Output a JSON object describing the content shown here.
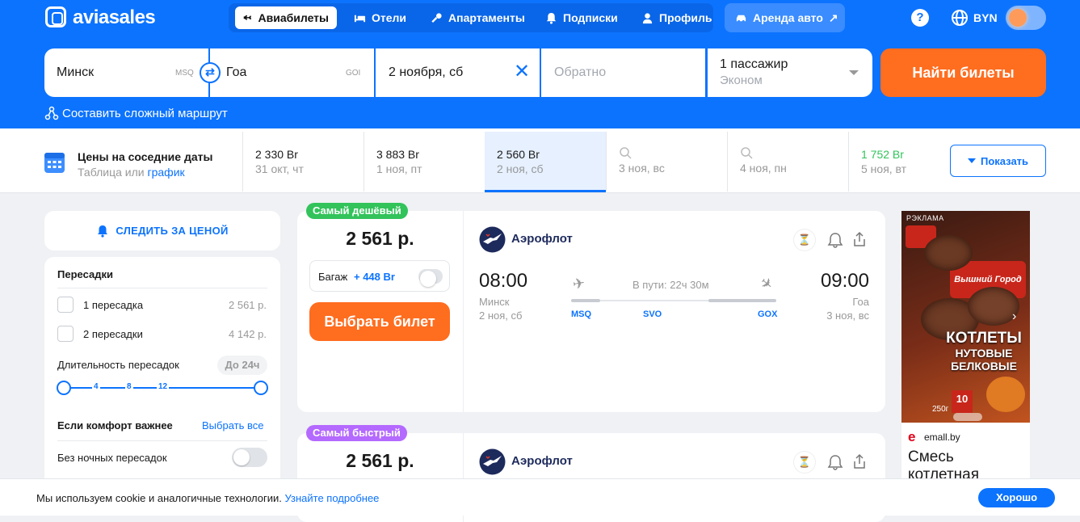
{
  "header": {
    "logo": "aviasales",
    "nav": [
      {
        "label": "Авиабилеты"
      },
      {
        "label": "Отели"
      },
      {
        "label": "Апартаменты"
      },
      {
        "label": "Подписки"
      },
      {
        "label": "Профиль"
      }
    ],
    "rent": "Аренда авто",
    "currency": "BYN",
    "help": "?"
  },
  "search": {
    "from": "Минск",
    "from_code": "MSQ",
    "to": "Гоа",
    "to_code": "GOI",
    "depart": "2 ноября, сб",
    "return_placeholder": "Обратно",
    "passengers": "1 пассажир",
    "cabin": "Эконом",
    "submit": "Найти билеты",
    "complex_route": "Составить сложный маршрут"
  },
  "dates": {
    "title": "Цены на соседние даты",
    "table": "Таблица",
    "or": "или",
    "graph": "график",
    "items": [
      {
        "price": "2 330 Br",
        "date": "31 окт, чт"
      },
      {
        "price": "3 883 Br",
        "date": "1 ноя, пт"
      },
      {
        "price": "2 560 Br",
        "date": "2 ноя, сб"
      },
      {
        "price": "",
        "date": "3 ноя, вс"
      },
      {
        "price": "",
        "date": "4 ноя, пн"
      },
      {
        "price": "1 752 Br",
        "date": "5 ноя, вт"
      }
    ],
    "show": "Показать"
  },
  "sidebar": {
    "follow": "СЛЕДИТЬ ЗА ЦЕНОЙ",
    "transfers_title": "Пересадки",
    "transfers": [
      {
        "label": "1 пересадка",
        "price": "2 561 р."
      },
      {
        "label": "2 пересадки",
        "price": "4 142 р."
      }
    ],
    "duration_title": "Длительность пересадок",
    "duration_value": "До 24ч",
    "ticks": [
      "4",
      "8",
      "12"
    ],
    "comfort_title": "Если комфорт важнее",
    "select_all": "Выбрать все",
    "no_night": "Без ночных пересадок"
  },
  "tickets": [
    {
      "badge": "Самый дешёвый",
      "price": "2 561 р.",
      "baggage": "Багаж",
      "baggage_price": "+ 448 Br",
      "choose": "Выбрать билет",
      "airline": "Аэрофлот",
      "dep_time": "08:00",
      "dep_city": "Минск",
      "dep_date": "2 ноя, сб",
      "duration": "В пути: 22ч 30м",
      "arr_time": "09:00",
      "arr_city": "Гоа",
      "arr_date": "3 ноя, вс",
      "codes": [
        "MSQ",
        "SVO",
        "GOX"
      ]
    },
    {
      "badge": "Самый быстрый",
      "price": "2 561 р.",
      "airline": "Аэрофлот"
    }
  ],
  "ad": {
    "tag": "РЭКЛАМА",
    "brand_line": "Вышний Город",
    "product": "КОТЛЕТЫ",
    "product2": "НУТОВЫЕ",
    "product3": "БЕЛКОВЫЕ",
    "weight": "250г",
    "count": "10",
    "shop": "emall.by",
    "title": "Смесь котлетная"
  },
  "cookie": {
    "text": "Мы используем cookie и аналогичные технологии.",
    "link": "Узнайте подробнее",
    "ok": "Хорошо"
  },
  "colors": {
    "brand": "#0c73fe",
    "cta": "#ff6d1f",
    "green": "#32c35b",
    "purple": "#b469ff"
  }
}
